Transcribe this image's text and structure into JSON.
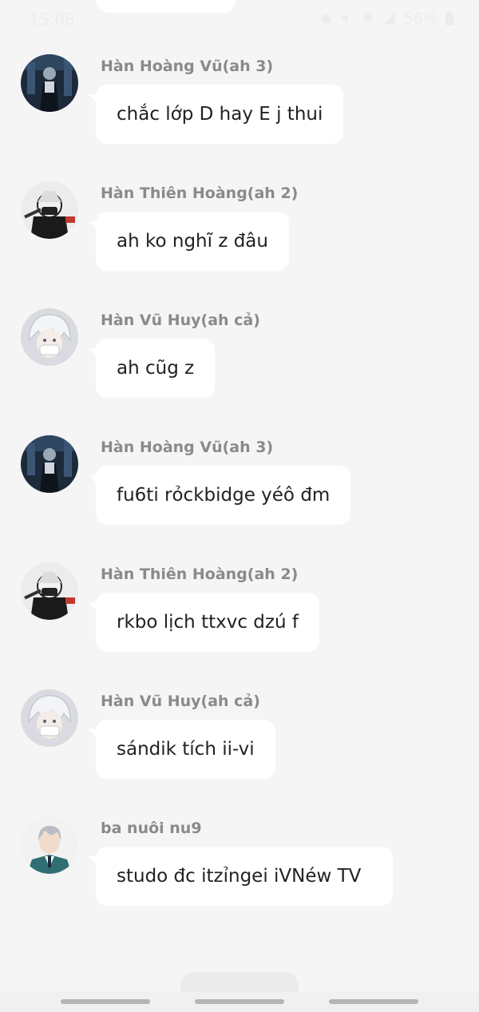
{
  "status_bar": {
    "time": "15:08",
    "battery": "56%",
    "icons": [
      "alarm-icon",
      "mute-icon",
      "wifi-icon",
      "signal-icon",
      "battery-icon"
    ]
  },
  "messages": [
    {
      "sender": "Hàn Hoàng Vũ(ah 3)",
      "text": "chắc lớp D hay E j thui",
      "avatar": "dark-figure-avatar"
    },
    {
      "sender": "Hàn Thiên Hoàng(ah 2)",
      "text": "ah ko nghĩ z đâu",
      "avatar": "masked-anime-avatar"
    },
    {
      "sender": "Hàn Vũ Huy(ah cả)",
      "text": "ah cũg z",
      "avatar": "white-hair-anime-avatar"
    },
    {
      "sender": "Hàn Hoàng Vũ(ah 3)",
      "text": "fu6ti rỏckbidge yéô đm",
      "avatar": "dark-figure-avatar"
    },
    {
      "sender": "Hàn Thiên Hoàng(ah 2)",
      "text": "rkbo lịch ttxvc dzú f",
      "avatar": "masked-anime-avatar"
    },
    {
      "sender": "Hàn Vũ Huy(ah cả)",
      "text": "sándik tích ii-vi",
      "avatar": "white-hair-anime-avatar"
    },
    {
      "sender": "ba nuôi nu9",
      "text": "studo đc itzỉngei iVNéw TV",
      "avatar": "grey-hair-suit-avatar"
    }
  ],
  "colors": {
    "background": "#f5f5f5",
    "bubble": "#ffffff",
    "sender_name": "#8a8a8a",
    "message_text": "#222222"
  }
}
